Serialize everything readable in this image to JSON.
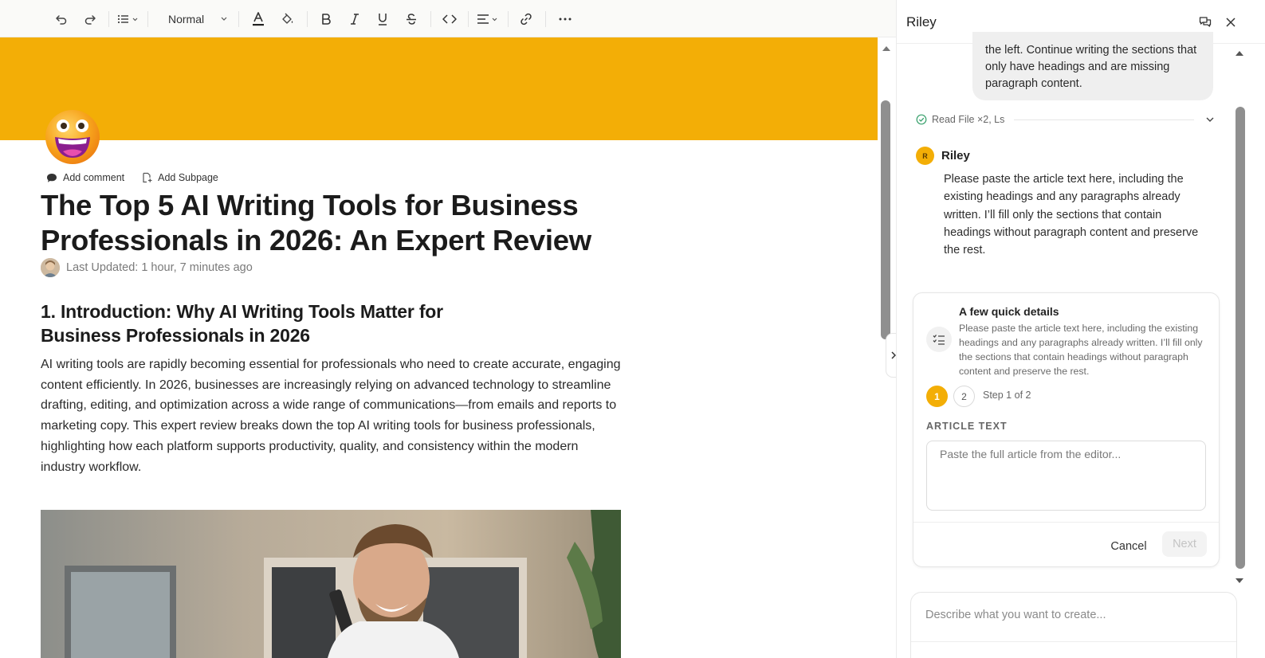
{
  "toolbar": {
    "text_style": "Normal"
  },
  "page": {
    "add_comment_label": "Add comment",
    "add_subpage_label": "Add Subpage",
    "title": "The Top 5 AI Writing Tools for Business Professionals in 2026: An Expert Review",
    "last_updated": "Last Updated: 1 hour, 7 minutes ago",
    "section_heading": "1. Introduction: Why AI Writing Tools Matter for Business Professionals in 2026",
    "section_paragraph": "AI writing tools are rapidly becoming essential for professionals who need to create accurate, engaging content efficiently. In 2026, businesses are increasingly relying on advanced technology to streamline drafting, editing, and optimization across a wide range of communications—from emails and reports to marketing copy. This expert review breaks down the top AI writing tools for business professionals, highlighting how each platform supports productivity, quality, and consistency within the modern industry workflow.",
    "cover_color": "#f3ae06"
  },
  "panel": {
    "title": "Riley",
    "user_message": "the left. Continue writing the sections that only have headings and are missing paragraph content.",
    "tool_summary": "Read File ×2, Ls",
    "assistant_initial": "R",
    "assistant_name": "Riley",
    "assistant_message": "Please paste the article text here, including the existing headings and any paragraphs already written. I’ll fill only the sections that contain headings without paragraph content and preserve the rest.",
    "card": {
      "title": "A few quick details",
      "description": "Please paste the article text here, including the existing headings and any paragraphs already written. I’ll fill only the sections that contain headings without paragraph content and preserve the rest.",
      "step_1": "1",
      "step_2": "2",
      "step_text": "Step 1 of 2",
      "field_label": "ARTICLE TEXT",
      "field_placeholder": "Paste the full article from the editor...",
      "cancel_label": "Cancel",
      "next_label": "Next"
    },
    "composer_placeholder": "Describe what you want to create..."
  },
  "colors": {
    "accent": "#f3ae06"
  }
}
